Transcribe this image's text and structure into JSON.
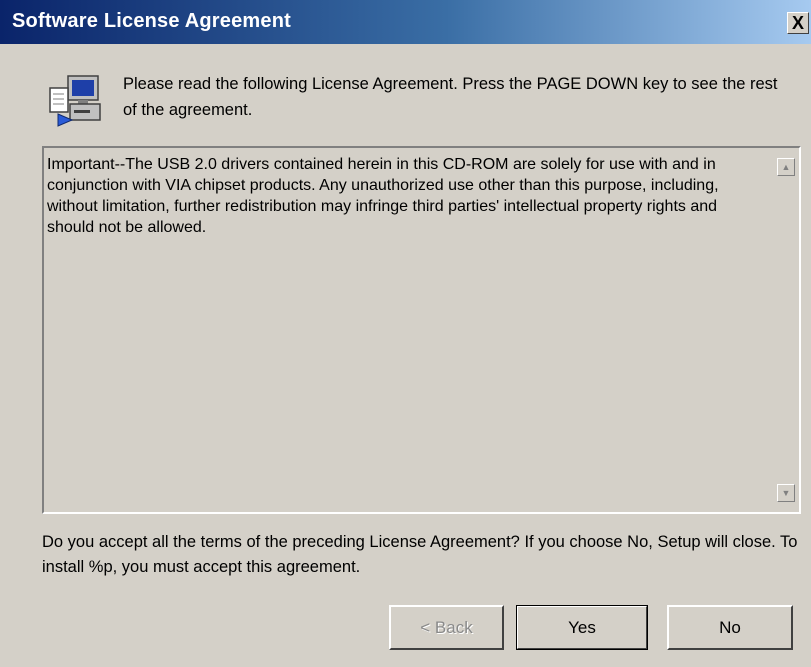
{
  "window": {
    "title": "Software License Agreement",
    "close_glyph": "X"
  },
  "header": {
    "icon": "computer-setup-icon",
    "instruction": "Please read the following License Agreement.  Press the PAGE DOWN key to see the rest of the agreement."
  },
  "license": {
    "text": "Important--The USB 2.0 drivers contained herein in this CD-ROM are solely for use with and in conjunction with VIA chipset products. Any unauthorized use other than this purpose, including, without limitation, further redistribution may infringe third parties' intellectual property rights and should not be allowed."
  },
  "question": "Do you accept all the terms of the preceding License Agreement?  If you choose No,  Setup will close.  To install %p, you must accept this agreement.",
  "buttons": {
    "back": "< Back",
    "yes": "Yes",
    "no": "No"
  },
  "colors": {
    "titlebar_start": "#0a246a",
    "titlebar_end": "#a6caf0",
    "face": "#d4d0c8"
  }
}
